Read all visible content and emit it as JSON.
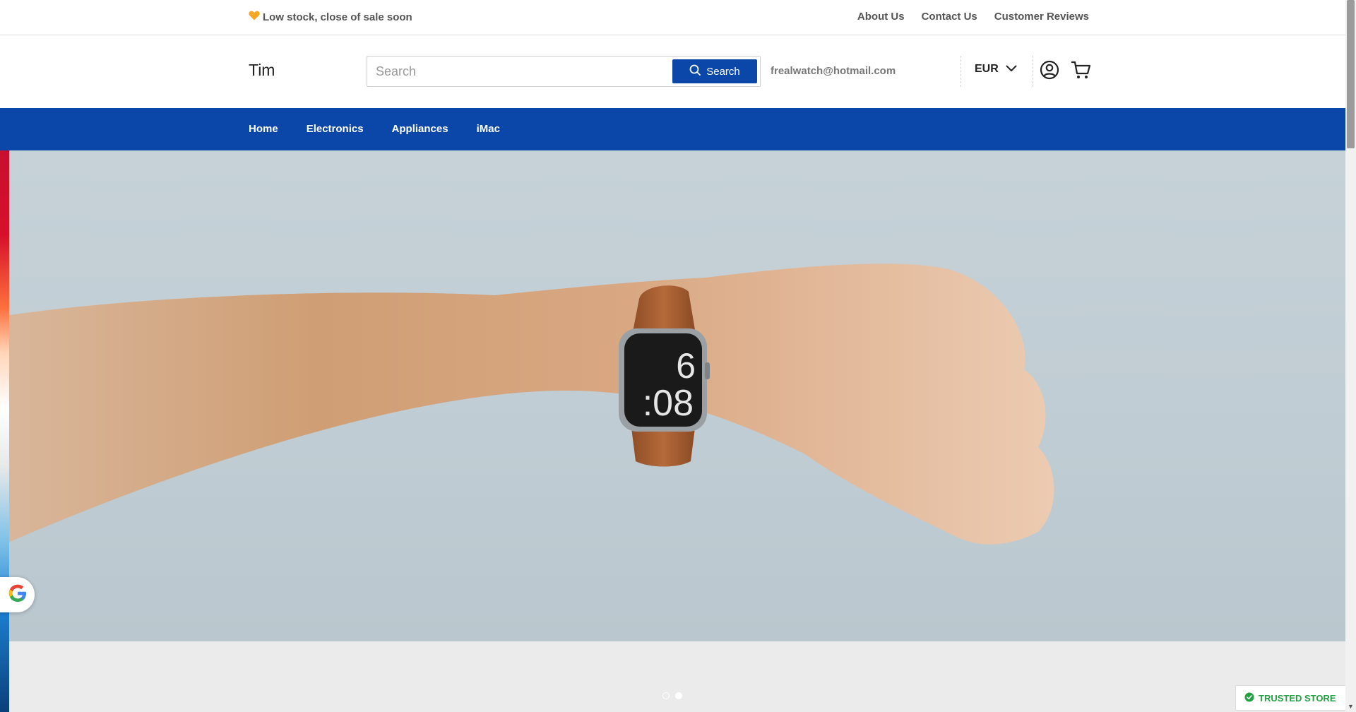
{
  "announcement": {
    "message": "Low stock, close of sale soon",
    "links": [
      "About Us",
      "Contact Us",
      "Customer Reviews"
    ]
  },
  "header": {
    "logo": "Tim",
    "search": {
      "placeholder": "Search",
      "value": "",
      "button_label": "Search"
    },
    "email": "frealwatch@hotmail.com",
    "currency": "EUR"
  },
  "nav": {
    "items": [
      "Home",
      "Electronics",
      "Appliances",
      "iMac"
    ]
  },
  "hero": {
    "watch_hour": "6",
    "watch_minutes": ":08",
    "slide_count": 2,
    "active_slide": 2
  },
  "badges": {
    "trusted": "TRUSTED STORE"
  },
  "colors": {
    "brand_blue": "#0a47a9",
    "trusted_green": "#23a043",
    "heart": "#f5a623"
  },
  "icons": [
    "heart-icon",
    "search-icon",
    "chevron-down-icon",
    "account-icon",
    "cart-icon",
    "google-icon",
    "shield-check-icon"
  ]
}
